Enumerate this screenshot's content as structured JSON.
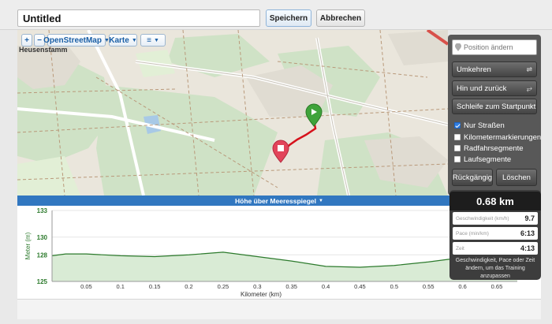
{
  "toolbar": {
    "title_value": "Untitled",
    "save_label": "Speichern",
    "cancel_label": "Abbrechen"
  },
  "map": {
    "zoom_in": "+",
    "zoom_out": "−",
    "layer_source": "OpenStreetMap",
    "map_type": "Karte",
    "place_labels": [
      "Heusenstamm"
    ]
  },
  "panel": {
    "position_placeholder": "Position ändern",
    "reverse_label": "Umkehren",
    "out_and_back_label": "Hin und zurück",
    "loop_label": "Schleife zum Startpunkt",
    "options": [
      {
        "label": "Nur Straßen",
        "checked": true
      },
      {
        "label": "Kilometermarkierungen",
        "checked": false
      },
      {
        "label": "Radfahrsegmente",
        "checked": false
      },
      {
        "label": "Laufsegmente",
        "checked": false
      }
    ],
    "undo_label": "Rückgängig",
    "clear_label": "Löschen"
  },
  "elevation": {
    "header": "Höhe über Meeresspiegel"
  },
  "stats": {
    "distance": "0.68 km",
    "speed_label": "Geschwindigkeit (km/h)",
    "speed_value": "9.7",
    "pace_label": "Pace (min/km)",
    "pace_value": "6:13",
    "time_label": "Zeit",
    "time_value": "4:13",
    "note": "Geschwindigkeit, Pace oder Zeit ändern, um das Training anzupassen"
  },
  "chart_data": {
    "type": "area",
    "xlabel": "Kilometer (km)",
    "ylabel": "Meter (m)",
    "xlim": [
      0,
      0.68
    ],
    "ylim": [
      125,
      133
    ],
    "yticks": [
      125,
      128,
      130,
      133
    ],
    "xticks": [
      0.05,
      0.1,
      0.15,
      0.2,
      0.25,
      0.3,
      0.35,
      0.4,
      0.45,
      0.5,
      0.55,
      0.6,
      0.65
    ],
    "x": [
      0,
      0.02,
      0.05,
      0.1,
      0.15,
      0.2,
      0.25,
      0.3,
      0.35,
      0.4,
      0.45,
      0.5,
      0.55,
      0.6,
      0.65,
      0.68
    ],
    "y": [
      127.9,
      128.1,
      128.1,
      127.9,
      127.8,
      128.0,
      128.3,
      127.8,
      127.3,
      126.7,
      126.6,
      126.8,
      127.2,
      127.7,
      127.8,
      127.8
    ],
    "colors": {
      "line": "#2c7a2c",
      "fill": "#d9ebd5"
    }
  }
}
